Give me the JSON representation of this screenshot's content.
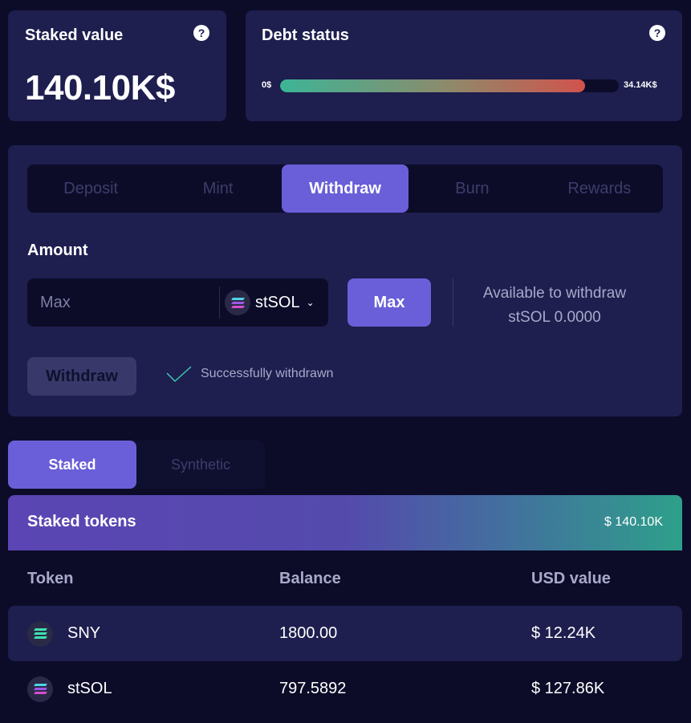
{
  "staked_card": {
    "title": "Staked value",
    "value": "140.10K$",
    "help": "?"
  },
  "debt_card": {
    "title": "Debt status",
    "help": "?",
    "min_label": "0$",
    "max_label": "34.14K$",
    "fill_fraction": 0.9
  },
  "action_tabs": [
    {
      "label": "Deposit",
      "active": false
    },
    {
      "label": "Mint",
      "active": false
    },
    {
      "label": "Withdraw",
      "active": true
    },
    {
      "label": "Burn",
      "active": false
    },
    {
      "label": "Rewards",
      "active": false
    }
  ],
  "amount": {
    "label": "Amount",
    "placeholder": "Max",
    "token": "stSOL",
    "max_button": "Max",
    "available_label": "Available to withdraw",
    "available_value": "stSOL 0.0000"
  },
  "withdraw_button": "Withdraw",
  "success_message": "Successfully withdrawn",
  "list_tabs": [
    {
      "label": "Staked",
      "active": true
    },
    {
      "label": "Synthetic",
      "active": false
    }
  ],
  "staked_tokens": {
    "title": "Staked tokens",
    "total": "$ 140.10K",
    "columns": [
      "Token",
      "Balance",
      "USD value"
    ],
    "rows": [
      {
        "token": "SNY",
        "balance": "1800.00",
        "usd": "$ 12.24K",
        "icon": "sny-icon"
      },
      {
        "token": "stSOL",
        "balance": "797.5892",
        "usd": "$ 127.86K",
        "icon": "stsol-icon"
      }
    ]
  },
  "colors": {
    "accent": "#6a5fd8",
    "card": "#1e1e4f",
    "background": "#0c0c29"
  }
}
